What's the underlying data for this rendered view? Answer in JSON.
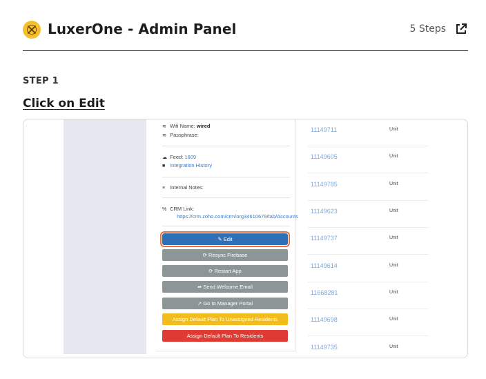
{
  "header": {
    "title": "LuxerOne - Admin Panel",
    "steps_label": "5 Steps",
    "logo_icon": "luxer-x-logo-icon",
    "external_icon": "external-link-icon",
    "brand_color": "#f5c02b"
  },
  "step": {
    "label": "STEP 1",
    "title": "Click on Edit"
  },
  "screenshot": {
    "fields": {
      "wifi_name_label": "Wifi Name:",
      "wifi_name_value": "wired",
      "passphrase_label": "Passphrase:",
      "feed_label": "Feed:",
      "feed_value": "1609",
      "integration_history": "Integration History",
      "internal_notes_label": "Internal Notes:",
      "crm_link_label": "CRM Link:",
      "crm_link_value": "https://crm.zoho.com/crm/org34610679/tab/Accounts"
    },
    "buttons": {
      "edit": "Edit",
      "resync": "Resync Firebase",
      "restart": "Restart App",
      "welcome": "Send Welcome Email",
      "manager": "Go to Manager Portal",
      "default_unassigned": "Assign Default Plan To Unassigned Residents",
      "default_residents": "Assign Default Plan To Residents"
    },
    "units": [
      {
        "id": "11149711",
        "label": "Unit"
      },
      {
        "id": "11149605",
        "label": "Unit"
      },
      {
        "id": "11149785",
        "label": "Unit"
      },
      {
        "id": "11149623",
        "label": "Unit"
      },
      {
        "id": "11149737",
        "label": "Unit"
      },
      {
        "id": "11149614",
        "label": "Unit"
      },
      {
        "id": "11668281",
        "label": "Unit"
      },
      {
        "id": "11149698",
        "label": "Unit"
      },
      {
        "id": "11149735",
        "label": "Unit"
      }
    ],
    "colors": {
      "edit_button": "#2f6fb5",
      "highlight": "#e8703a",
      "gray_button": "#8c9696",
      "yellow_button": "#f0bc1e",
      "red_button": "#df3b32",
      "unit_id": "#7fa8d8"
    }
  }
}
